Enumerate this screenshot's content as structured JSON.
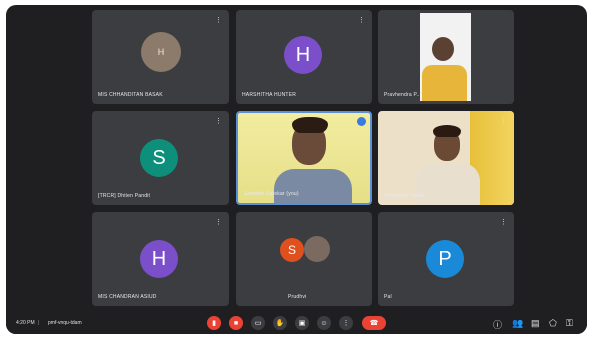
{
  "tiles": [
    {
      "name": "MIS CHHANDITAN BASAK"
    },
    {
      "name": "HARSHITHA HUNTER"
    },
    {
      "name": "Pravhendra P..."
    },
    {
      "name": "[TRCR] Dhiten Pandit"
    },
    {
      "name": "Samarth Karekar (you)"
    },
    {
      "name": "Udyanjeet Yadav"
    },
    {
      "name": "MIS CHANDRAN ASIUD"
    },
    {
      "name": "Prudhvi"
    },
    {
      "name": "Pal"
    }
  ],
  "avatars": {
    "h1": "H",
    "s": "S",
    "h2": "H",
    "s2": "S",
    "p": "P"
  },
  "bottom": {
    "time": "4:20 PM",
    "meeting": "pmf-vnqu-tdam"
  },
  "colors": {
    "purple": "#7b4fc9",
    "teal": "#0d8f7c",
    "blue": "#1a8ad8",
    "red": "#ea4335",
    "orange_avatar": "#e0501e"
  },
  "icons": [
    "mic-icon",
    "camera-icon",
    "captions-icon",
    "raise-hand-icon",
    "present-icon",
    "more-icon",
    "end-call-icon",
    "info-icon",
    "people-icon",
    "chat-icon",
    "activities-icon",
    "lock-icon"
  ]
}
